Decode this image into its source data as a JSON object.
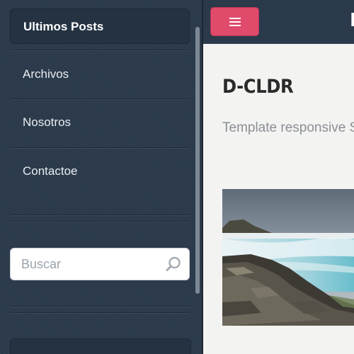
{
  "sidebar": {
    "items": [
      {
        "label": "Ultimos Posts",
        "active": true
      },
      {
        "label": "Archivos"
      },
      {
        "label": "Nosotros"
      },
      {
        "label": "Contactoe"
      }
    ],
    "search": {
      "placeholder": "Buscar",
      "icon": "search-icon"
    }
  },
  "header": {
    "menu_icon": "hamburger-icon",
    "site_initial": "D",
    "accent_color": "#e04a6b"
  },
  "main": {
    "title": "D-CLDR",
    "subtitle": "Template responsive Solutions"
  }
}
